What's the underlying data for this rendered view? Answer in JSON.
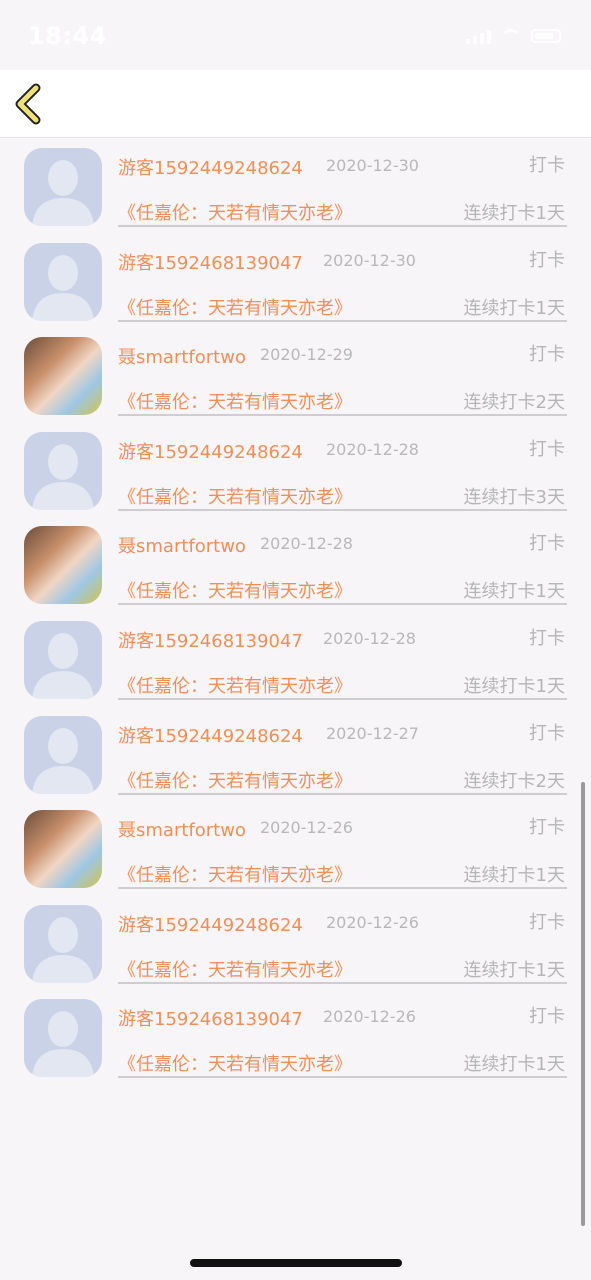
{
  "status_bar": {
    "time": "18:44"
  },
  "rows": [
    {
      "avatar": "default-avatar",
      "name": "游客1592449248624",
      "date": "2020-12-30",
      "label": "打卡",
      "book": "《任嘉伦：天若有情天亦老》",
      "streak": "连续打卡1天"
    },
    {
      "avatar": "default-avatar",
      "name": "游客1592468139047",
      "date": "2020-12-30",
      "label": "打卡",
      "book": "《任嘉伦：天若有情天亦老》",
      "streak": "连续打卡1天"
    },
    {
      "avatar": "photo-avatar",
      "name": "聂smartfortwo",
      "date": "2020-12-29",
      "label": "打卡",
      "book": "《任嘉伦：天若有情天亦老》",
      "streak": "连续打卡2天"
    },
    {
      "avatar": "default-avatar",
      "name": "游客1592449248624",
      "date": "2020-12-28",
      "label": "打卡",
      "book": "《任嘉伦：天若有情天亦老》",
      "streak": "连续打卡3天"
    },
    {
      "avatar": "photo-avatar",
      "name": "聂smartfortwo",
      "date": "2020-12-28",
      "label": "打卡",
      "book": "《任嘉伦：天若有情天亦老》",
      "streak": "连续打卡1天"
    },
    {
      "avatar": "default-avatar",
      "name": "游客1592468139047",
      "date": "2020-12-28",
      "label": "打卡",
      "book": "《任嘉伦：天若有情天亦老》",
      "streak": "连续打卡1天"
    },
    {
      "avatar": "default-avatar",
      "name": "游客1592449248624",
      "date": "2020-12-27",
      "label": "打卡",
      "book": "《任嘉伦：天若有情天亦老》",
      "streak": "连续打卡2天"
    },
    {
      "avatar": "photo-avatar",
      "name": "聂smartfortwo",
      "date": "2020-12-26",
      "label": "打卡",
      "book": "《任嘉伦：天若有情天亦老》",
      "streak": "连续打卡1天"
    },
    {
      "avatar": "default-avatar",
      "name": "游客1592449248624",
      "date": "2020-12-26",
      "label": "打卡",
      "book": "《任嘉伦：天若有情天亦老》",
      "streak": "连续打卡1天"
    },
    {
      "avatar": "default-avatar",
      "name": "游客1592468139047",
      "date": "2020-12-26",
      "label": "打卡",
      "book": "《任嘉伦：天若有情天亦老》",
      "streak": "连续打卡1天"
    }
  ],
  "colors": {
    "accent": "#ef8f58",
    "muted": "#b5b5b5",
    "back_arrow": "#f0e07a"
  }
}
